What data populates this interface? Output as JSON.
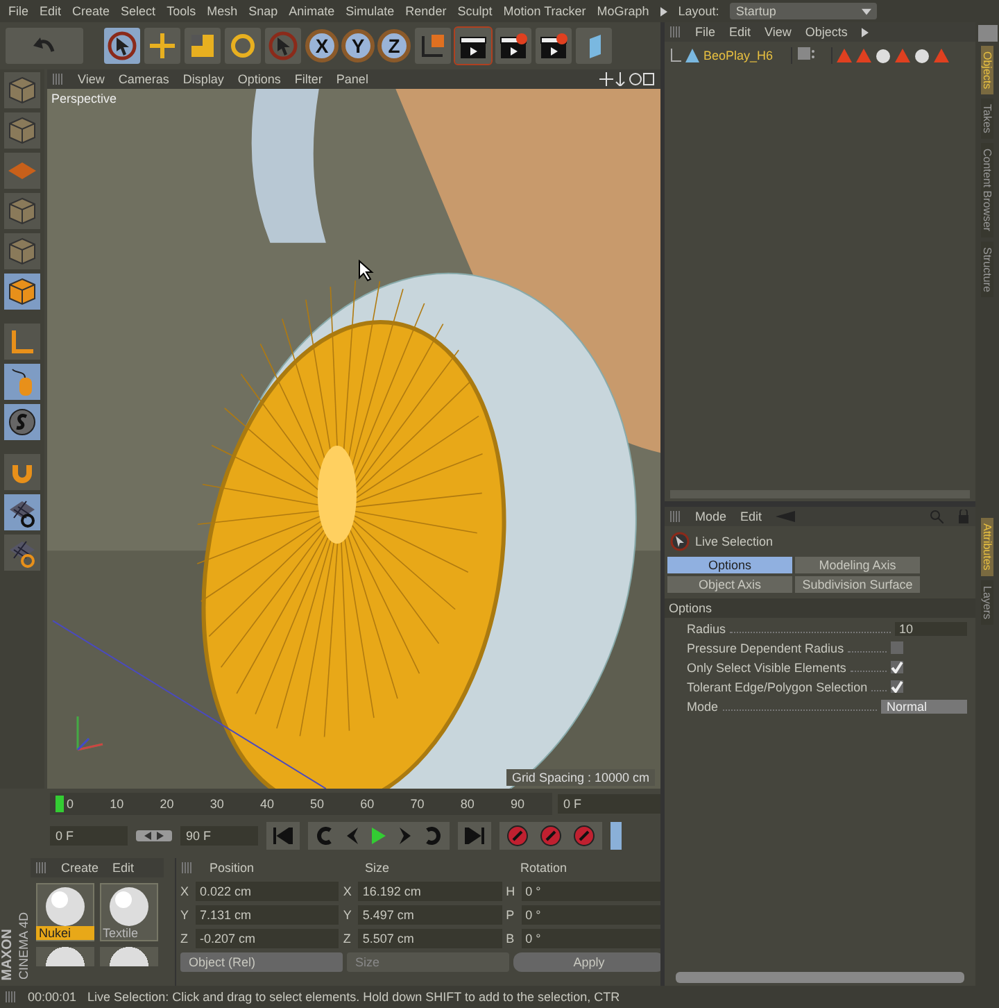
{
  "menu_bar": {
    "items": [
      "File",
      "Edit",
      "Create",
      "Select",
      "Tools",
      "Mesh",
      "Snap",
      "Animate",
      "Simulate",
      "Render",
      "Sculpt",
      "Motion Tracker",
      "MoGraph"
    ],
    "layout_label": "Layout:",
    "layout_value": "Startup"
  },
  "axis_buttons": [
    {
      "label": "X",
      "selected": true
    },
    {
      "label": "Y",
      "selected": true
    },
    {
      "label": "Z",
      "selected": true
    }
  ],
  "viewport": {
    "menu": [
      "View",
      "Cameras",
      "Display",
      "Options",
      "Filter",
      "Panel"
    ],
    "camera_label": "Perspective",
    "grid_label": "Grid Spacing : 10000 cm"
  },
  "object_manager": {
    "menu": [
      "File",
      "Edit",
      "View",
      "Objects"
    ],
    "objects": [
      {
        "name": "BeoPlay_H6",
        "selected": true
      }
    ]
  },
  "side_tabs_top": [
    {
      "label": "Objects",
      "selected": true
    },
    {
      "label": "Takes",
      "selected": false
    },
    {
      "label": "Content Browser",
      "selected": false
    },
    {
      "label": "Structure",
      "selected": false
    }
  ],
  "side_tabs_bottom": [
    {
      "label": "Attributes",
      "selected": true
    },
    {
      "label": "Layers",
      "selected": false
    }
  ],
  "attributes": {
    "menu": [
      "Mode",
      "Edit"
    ],
    "tool_title": "Live Selection",
    "tabs": [
      {
        "label": "Options",
        "selected": true
      },
      {
        "label": "Modeling Axis",
        "selected": false
      },
      {
        "label": "Object Axis",
        "selected": false
      },
      {
        "label": "Subdivision Surface",
        "selected": false
      }
    ],
    "section": "Options",
    "params": [
      {
        "kind": "number",
        "label": "Radius",
        "value": "10"
      },
      {
        "kind": "checkbox",
        "label": "Pressure Dependent Radius",
        "checked": false
      },
      {
        "kind": "checkbox",
        "label": "Only Select Visible Elements",
        "checked": true
      },
      {
        "kind": "checkbox",
        "label": "Tolerant Edge/Polygon Selection",
        "checked": true
      },
      {
        "kind": "dropdown",
        "label": "Mode",
        "value": "Normal"
      }
    ]
  },
  "timeline": {
    "ticks": [
      "0",
      "10",
      "20",
      "30",
      "40",
      "50",
      "60",
      "70",
      "80",
      "90"
    ],
    "frame": "0 F"
  },
  "transport": {
    "start": "0 F",
    "end": "90 F"
  },
  "materials": {
    "menu": [
      "Create",
      "Edit"
    ],
    "items": [
      {
        "name": "Nukei",
        "selected": true
      },
      {
        "name": "Textile",
        "selected": false
      }
    ]
  },
  "logo": {
    "brand": "MAXON",
    "product": "CINEMA 4D"
  },
  "coordinates": {
    "headers": [
      "Position",
      "Size",
      "Rotation"
    ],
    "rows": [
      {
        "pos_axis": "X",
        "pos": "0.022 cm",
        "size_axis": "X",
        "size": "16.192 cm",
        "rot_axis": "H",
        "rot": "0 °"
      },
      {
        "pos_axis": "Y",
        "pos": "7.131 cm",
        "size_axis": "Y",
        "size": "5.497 cm",
        "rot_axis": "P",
        "rot": "0 °"
      },
      {
        "pos_axis": "Z",
        "pos": "-0.207 cm",
        "size_axis": "Z",
        "size": "5.507 cm",
        "rot_axis": "B",
        "rot": "0 °"
      }
    ],
    "space": "Object (Rel)",
    "size_mode": "Size",
    "apply": "Apply"
  },
  "status_bar": {
    "time": "00:00:01",
    "message": "Live Selection: Click and drag to select elements. Hold down SHIFT to add to the selection, CTR"
  }
}
